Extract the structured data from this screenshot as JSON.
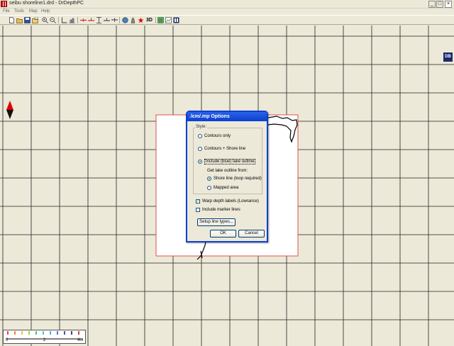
{
  "window": {
    "title": "seibu shoreline1.drd - DrDepthPC",
    "minimize_glyph": "_",
    "maximize_glyph": "□",
    "close_glyph": "×"
  },
  "menu": [
    "File",
    "Tools",
    "Map",
    "Help"
  ],
  "toolbar": {
    "icons": [
      "new-file-icon",
      "open-folder-icon",
      "save-icon",
      "open-folder-alt-icon",
      "zoom-in-icon",
      "zoom-out-icon",
      "depth-axis-icon",
      "chart-icon",
      "red-line-icon-1",
      "red-line-icon-2",
      "blue-line-icon-1",
      "blue-line-icon-2",
      "blue-line-icon-3",
      "globe-icon",
      "weight-icon",
      "red-star-icon",
      "three-d-label",
      "green-grid-icon",
      "chart-grid-icon",
      "db-icon"
    ],
    "three_d_label": "3D"
  },
  "canvas": {
    "logo_text": "DB",
    "map_frame_color": "#e05050",
    "scale": {
      "start": "0",
      "mid": "2",
      "end": "4m"
    }
  },
  "dialog": {
    "title": ".lcm/.mp Options",
    "style_legend": "Style:",
    "options": [
      {
        "label": "Contours only",
        "selected": false
      },
      {
        "label": "Contours + Shore line",
        "selected": false
      },
      {
        "label": "Include (blue) lake outline",
        "selected": true
      }
    ],
    "outline_heading": "Get lake outline from:",
    "outline_options": [
      {
        "label": "Shore line (loop required)",
        "selected": true
      },
      {
        "label": "Mapped area",
        "selected": false
      }
    ],
    "checkboxes": [
      {
        "label": "Warp depth labels (Lowrance)",
        "checked": true
      },
      {
        "label": "Include marker lines",
        "checked": false
      }
    ],
    "setup_button": "Setup line types...",
    "ok_button": "OK",
    "cancel_button": "Cancel"
  }
}
